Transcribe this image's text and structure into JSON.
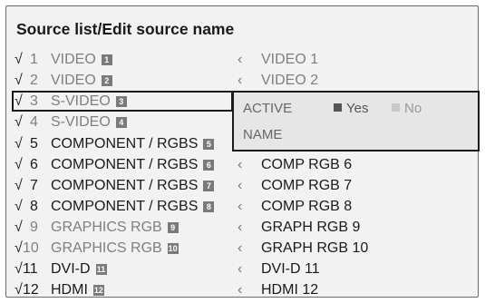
{
  "title": "Source list/Edit source name",
  "sources": [
    {
      "check": "√",
      "num": "1",
      "name": "VIDEO",
      "badge": "1",
      "alias": "VIDEO 1"
    },
    {
      "check": "√",
      "num": "2",
      "name": "VIDEO",
      "badge": "2",
      "alias": "VIDEO 2"
    },
    {
      "check": "√",
      "num": "3",
      "name": "S-VIDEO",
      "badge": "3",
      "alias": ""
    },
    {
      "check": "√",
      "num": "4",
      "name": "S-VIDEO",
      "badge": "4",
      "alias": ""
    },
    {
      "check": "√",
      "num": "5",
      "name": "COMPONENT / RGBS",
      "badge": "5",
      "alias": ""
    },
    {
      "check": "√",
      "num": "6",
      "name": "COMPONENT / RGBS",
      "badge": "6",
      "alias": "COMP RGB 6"
    },
    {
      "check": "√",
      "num": "7",
      "name": "COMPONENT / RGBS",
      "badge": "7",
      "alias": "COMP RGB 7"
    },
    {
      "check": "√",
      "num": "8",
      "name": "COMPONENT / RGBS",
      "badge": "8",
      "alias": "COMP RGB 8"
    },
    {
      "check": "√",
      "num": "9",
      "name": "GRAPHICS RGB",
      "badge": "9",
      "alias": "GRAPH RGB 9"
    },
    {
      "check": "√",
      "num": "10",
      "name": "GRAPHICS RGB",
      "badge": "10",
      "alias": "GRAPH RGB 10"
    },
    {
      "check": "√",
      "num": "11",
      "name": "DVI-D",
      "badge": "11",
      "alias": "DVI-D 11"
    },
    {
      "check": "√",
      "num": "12",
      "name": "HDMI",
      "badge": "12",
      "alias": "HDMI 12"
    }
  ],
  "popup": {
    "active_label": "ACTIVE",
    "yes_label": "Yes",
    "no_label": "No",
    "name_label": "NAME",
    "active_value": "Yes"
  },
  "chevron": "‹",
  "colors": {
    "background": "#f2f2f2",
    "selection_border": "#1a1a1a",
    "badge": "#7a7a7a"
  }
}
